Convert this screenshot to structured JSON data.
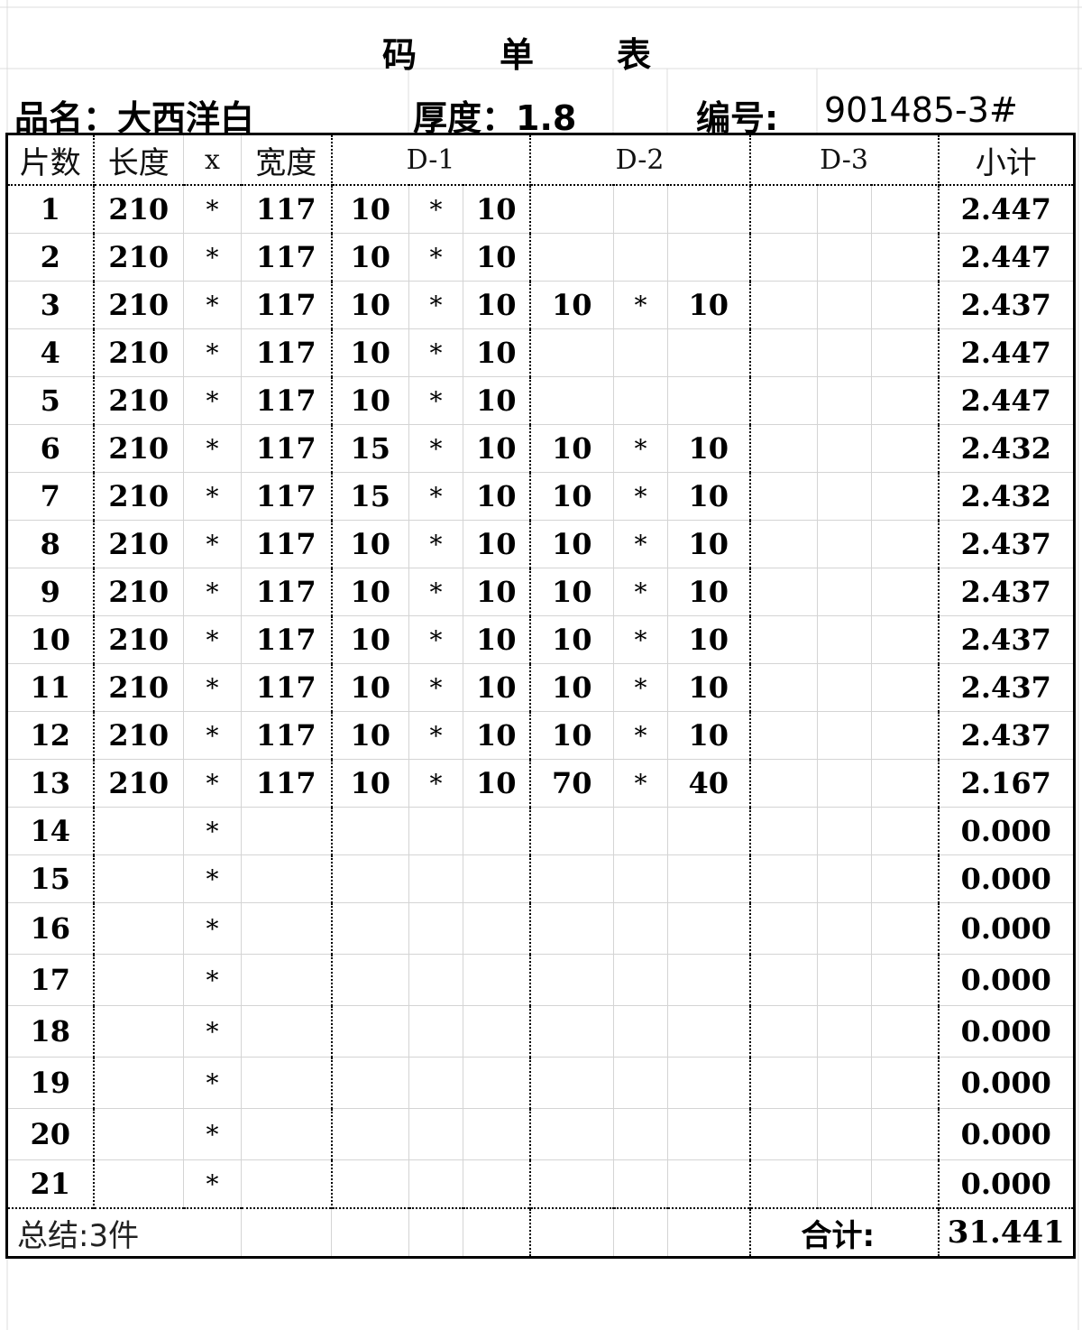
{
  "title": [
    "码",
    "单",
    "表"
  ],
  "info": {
    "name": "品名：大西洋白",
    "thickness": "厚度：1.8",
    "code_label": "编号:",
    "code_value": "901485-3#"
  },
  "table": {
    "headers": {
      "pieces": "片数",
      "length": "长度",
      "x": "x",
      "width": "宽度",
      "d1": "D-1",
      "d2": "D-2",
      "d3": "D-3",
      "subtotal": "小计"
    },
    "rows": [
      {
        "n": "1",
        "l": "210",
        "s": "*",
        "w": "117",
        "d1a": "10",
        "d1s": "*",
        "d1b": "10",
        "d2a": "",
        "d2s": "",
        "d2b": "",
        "sub": "2.447"
      },
      {
        "n": "2",
        "l": "210",
        "s": "*",
        "w": "117",
        "d1a": "10",
        "d1s": "*",
        "d1b": "10",
        "d2a": "",
        "d2s": "",
        "d2b": "",
        "sub": "2.447"
      },
      {
        "n": "3",
        "l": "210",
        "s": "*",
        "w": "117",
        "d1a": "10",
        "d1s": "*",
        "d1b": "10",
        "d2a": "10",
        "d2s": "*",
        "d2b": "10",
        "sub": "2.437"
      },
      {
        "n": "4",
        "l": "210",
        "s": "*",
        "w": "117",
        "d1a": "10",
        "d1s": "*",
        "d1b": "10",
        "d2a": "",
        "d2s": "",
        "d2b": "",
        "sub": "2.447"
      },
      {
        "n": "5",
        "l": "210",
        "s": "*",
        "w": "117",
        "d1a": "10",
        "d1s": "*",
        "d1b": "10",
        "d2a": "",
        "d2s": "",
        "d2b": "",
        "sub": "2.447"
      },
      {
        "n": "6",
        "l": "210",
        "s": "*",
        "w": "117",
        "d1a": "15",
        "d1s": "*",
        "d1b": "10",
        "d2a": "10",
        "d2s": "*",
        "d2b": "10",
        "sub": "2.432"
      },
      {
        "n": "7",
        "l": "210",
        "s": "*",
        "w": "117",
        "d1a": "15",
        "d1s": "*",
        "d1b": "10",
        "d2a": "10",
        "d2s": "*",
        "d2b": "10",
        "sub": "2.432"
      },
      {
        "n": "8",
        "l": "210",
        "s": "*",
        "w": "117",
        "d1a": "10",
        "d1s": "*",
        "d1b": "10",
        "d2a": "10",
        "d2s": "*",
        "d2b": "10",
        "sub": "2.437"
      },
      {
        "n": "9",
        "l": "210",
        "s": "*",
        "w": "117",
        "d1a": "10",
        "d1s": "*",
        "d1b": "10",
        "d2a": "10",
        "d2s": "*",
        "d2b": "10",
        "sub": "2.437"
      },
      {
        "n": "10",
        "l": "210",
        "s": "*",
        "w": "117",
        "d1a": "10",
        "d1s": "*",
        "d1b": "10",
        "d2a": "10",
        "d2s": "*",
        "d2b": "10",
        "sub": "2.437"
      },
      {
        "n": "11",
        "l": "210",
        "s": "*",
        "w": "117",
        "d1a": "10",
        "d1s": "*",
        "d1b": "10",
        "d2a": "10",
        "d2s": "*",
        "d2b": "10",
        "sub": "2.437"
      },
      {
        "n": "12",
        "l": "210",
        "s": "*",
        "w": "117",
        "d1a": "10",
        "d1s": "*",
        "d1b": "10",
        "d2a": "10",
        "d2s": "*",
        "d2b": "10",
        "sub": "2.437"
      },
      {
        "n": "13",
        "l": "210",
        "s": "*",
        "w": "117",
        "d1a": "10",
        "d1s": "*",
        "d1b": "10",
        "d2a": "70",
        "d2s": "*",
        "d2b": "40",
        "sub": "2.167"
      },
      {
        "n": "14",
        "l": "",
        "s": "*",
        "w": "",
        "d1a": "",
        "d1s": "",
        "d1b": "",
        "d2a": "",
        "d2s": "",
        "d2b": "",
        "sub": "0.000"
      },
      {
        "n": "15",
        "l": "",
        "s": "*",
        "w": "",
        "d1a": "",
        "d1s": "",
        "d1b": "",
        "d2a": "",
        "d2s": "",
        "d2b": "",
        "sub": "0.000"
      },
      {
        "n": "16",
        "l": "",
        "s": "*",
        "w": "",
        "d1a": "",
        "d1s": "",
        "d1b": "",
        "d2a": "",
        "d2s": "",
        "d2b": "",
        "sub": "0.000"
      },
      {
        "n": "17",
        "l": "",
        "s": "*",
        "w": "",
        "d1a": "",
        "d1s": "",
        "d1b": "",
        "d2a": "",
        "d2s": "",
        "d2b": "",
        "sub": "0.000"
      },
      {
        "n": "18",
        "l": "",
        "s": "*",
        "w": "",
        "d1a": "",
        "d1s": "",
        "d1b": "",
        "d2a": "",
        "d2s": "",
        "d2b": "",
        "sub": "0.000"
      },
      {
        "n": "19",
        "l": "",
        "s": "*",
        "w": "",
        "d1a": "",
        "d1s": "",
        "d1b": "",
        "d2a": "",
        "d2s": "",
        "d2b": "",
        "sub": "0.000"
      },
      {
        "n": "20",
        "l": "",
        "s": "*",
        "w": "",
        "d1a": "",
        "d1s": "",
        "d1b": "",
        "d2a": "",
        "d2s": "",
        "d2b": "",
        "sub": "0.000"
      },
      {
        "n": "21",
        "l": "",
        "s": "*",
        "w": "",
        "d1a": "",
        "d1s": "",
        "d1b": "",
        "d2a": "",
        "d2s": "",
        "d2b": "",
        "sub": "0.000"
      }
    ],
    "summary": {
      "count_text": "总结:3件",
      "total_label": "合计:",
      "total_value": "31.441"
    }
  }
}
